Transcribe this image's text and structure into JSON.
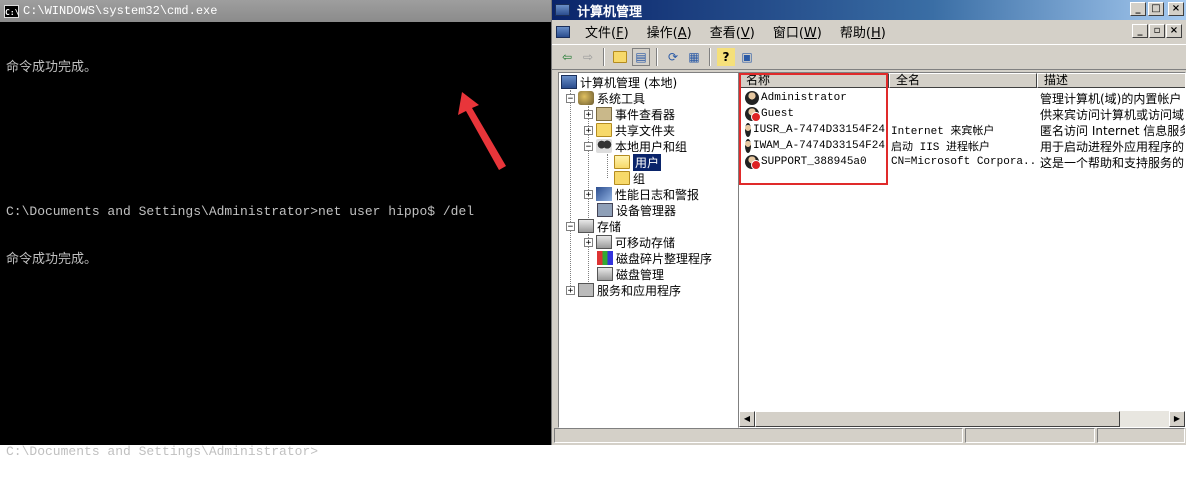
{
  "cmd": {
    "title": "C:\\WINDOWS\\system32\\cmd.exe",
    "icon": "cmd-icon",
    "lines": [
      "命令成功完成。",
      "",
      "",
      "C:\\Documents and Settings\\Administrator>net user hippo$ /del",
      "命令成功完成。",
      "",
      "",
      "",
      "C:\\Documents and Settings\\Administrator>"
    ]
  },
  "mmc": {
    "title": "计算机管理",
    "window_buttons": [
      "_",
      "□",
      "×"
    ],
    "mdi_buttons": [
      "_",
      "▫",
      "×"
    ],
    "menu": [
      {
        "label": "文件",
        "key": "F"
      },
      {
        "label": "操作",
        "key": "A"
      },
      {
        "label": "查看",
        "key": "V"
      },
      {
        "label": "窗口",
        "key": "W"
      },
      {
        "label": "帮助",
        "key": "H"
      }
    ],
    "toolbar": [
      "back-icon",
      "forward-icon",
      "up-folder-icon",
      "show-tree-icon",
      "refresh-icon",
      "export-icon",
      "help-icon",
      "properties-icon"
    ],
    "tree": {
      "root": "计算机管理 (本地)",
      "system_tools": "系统工具",
      "event_viewer": "事件查看器",
      "shared_folders": "共享文件夹",
      "local_users": "本地用户和组",
      "users": "用户",
      "groups": "组",
      "perf_logs": "性能日志和警报",
      "device_manager": "设备管理器",
      "storage": "存储",
      "removable": "可移动存储",
      "defrag": "磁盘碎片整理程序",
      "disk_mgmt": "磁盘管理",
      "services": "服务和应用程序"
    },
    "list": {
      "headers": [
        "名称",
        "全名",
        "描述"
      ],
      "rows": [
        {
          "name": "Administrator",
          "full": "",
          "desc": "管理计算机(域)的内置帐户",
          "disabled": false
        },
        {
          "name": "Guest",
          "full": "",
          "desc": "供来宾访问计算机或访问域",
          "disabled": true
        },
        {
          "name": "IUSR_A-7474D33154F24",
          "full": "Internet 来宾帐户",
          "desc": "匿名访问 Internet 信息服务",
          "disabled": false
        },
        {
          "name": "IWAM_A-7474D33154F24",
          "full": "启动 IIS 进程帐户",
          "desc": "用于启动进程外应用程序的",
          "disabled": false
        },
        {
          "name": "SUPPORT_388945a0",
          "full": "CN=Microsoft Corpora...",
          "desc": "这是一个帮助和支持服务的",
          "disabled": true
        }
      ]
    }
  },
  "colors": {
    "highlight_box": "#e02a2a",
    "title_active": "#0a246a",
    "cmd_text": "#c0c0c0"
  }
}
